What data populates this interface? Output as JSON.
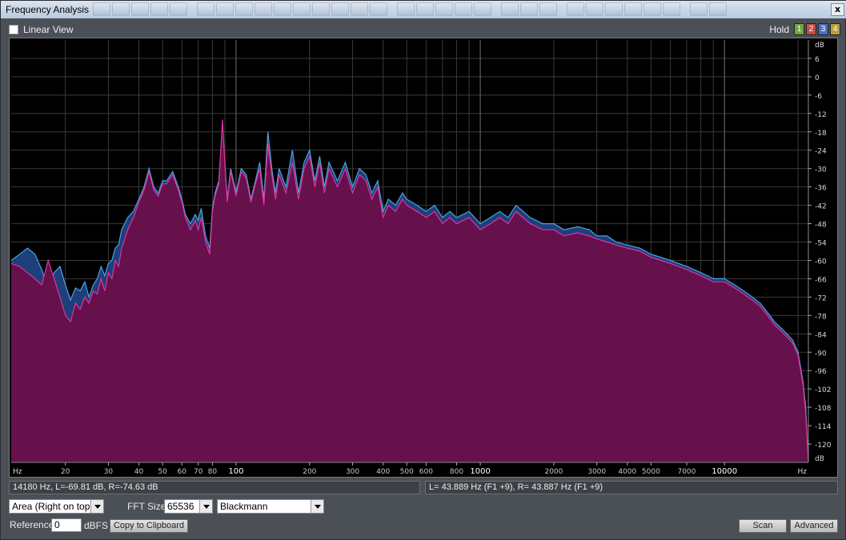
{
  "window": {
    "title": "Frequency Analysis",
    "close_label": "x"
  },
  "top": {
    "linear_view_label": "Linear View",
    "linear_view_checked": false,
    "hold_label": "Hold",
    "hold_buttons": [
      {
        "label": "1",
        "color": "#6ea83a"
      },
      {
        "label": "2",
        "color": "#c0504d"
      },
      {
        "label": "3",
        "color": "#4f6fc5"
      },
      {
        "label": "4",
        "color": "#b8a13a"
      }
    ]
  },
  "chart_data": {
    "type": "area",
    "x_scale": "log",
    "xlim": [
      12,
      22050
    ],
    "ylim": [
      -126,
      12
    ],
    "x_unit": "Hz",
    "y_unit": "dB",
    "x_ticks": [
      {
        "v": 20,
        "label": "20"
      },
      {
        "v": 30,
        "label": "30"
      },
      {
        "v": 40,
        "label": "40"
      },
      {
        "v": 50,
        "label": "50"
      },
      {
        "v": 60,
        "label": "60"
      },
      {
        "v": 70,
        "label": "70"
      },
      {
        "v": 80,
        "label": "80"
      },
      {
        "v": 100,
        "label": "100"
      },
      {
        "v": 200,
        "label": "200"
      },
      {
        "v": 300,
        "label": "300"
      },
      {
        "v": 400,
        "label": "400"
      },
      {
        "v": 500,
        "label": "500"
      },
      {
        "v": 600,
        "label": "600"
      },
      {
        "v": 800,
        "label": "800"
      },
      {
        "v": 1000,
        "label": "1000"
      },
      {
        "v": 2000,
        "label": "2000"
      },
      {
        "v": 3000,
        "label": "3000"
      },
      {
        "v": 4000,
        "label": "4000"
      },
      {
        "v": 5000,
        "label": "5000"
      },
      {
        "v": 7000,
        "label": "7000"
      },
      {
        "v": 10000,
        "label": "10000"
      }
    ],
    "y_ticks": [
      6,
      0,
      -6,
      -12,
      -18,
      -24,
      -30,
      -36,
      -42,
      -48,
      -54,
      -60,
      -66,
      -72,
      -78,
      -84,
      -90,
      -96,
      -102,
      -108,
      -114,
      -120
    ],
    "series": [
      {
        "channel": "L",
        "fill": "#1e3f7a",
        "stroke": "#4aa3e0",
        "points": [
          [
            12,
            -60
          ],
          [
            13,
            -58
          ],
          [
            14,
            -56
          ],
          [
            15,
            -58
          ],
          [
            16,
            -63
          ],
          [
            17,
            -69
          ],
          [
            18,
            -64
          ],
          [
            19,
            -62
          ],
          [
            20,
            -68
          ],
          [
            21,
            -73
          ],
          [
            22,
            -69
          ],
          [
            23,
            -70
          ],
          [
            24,
            -67
          ],
          [
            25,
            -72
          ],
          [
            26,
            -68
          ],
          [
            27,
            -66
          ],
          [
            28,
            -62
          ],
          [
            29,
            -65
          ],
          [
            30,
            -61
          ],
          [
            31,
            -60
          ],
          [
            32,
            -56
          ],
          [
            33,
            -55
          ],
          [
            34,
            -50
          ],
          [
            36,
            -46
          ],
          [
            38,
            -44
          ],
          [
            40,
            -40
          ],
          [
            42,
            -36
          ],
          [
            44,
            -30
          ],
          [
            46,
            -36
          ],
          [
            48,
            -38
          ],
          [
            50,
            -34
          ],
          [
            52,
            -34
          ],
          [
            55,
            -31
          ],
          [
            58,
            -36
          ],
          [
            60,
            -40
          ],
          [
            62,
            -45
          ],
          [
            65,
            -48
          ],
          [
            68,
            -45
          ],
          [
            70,
            -47
          ],
          [
            72,
            -43
          ],
          [
            75,
            -52
          ],
          [
            78,
            -56
          ],
          [
            80,
            -43
          ],
          [
            82,
            -38
          ],
          [
            85,
            -34
          ],
          [
            88,
            -16
          ],
          [
            90,
            -28
          ],
          [
            92,
            -40
          ],
          [
            95,
            -30
          ],
          [
            100,
            -38
          ],
          [
            105,
            -30
          ],
          [
            110,
            -32
          ],
          [
            115,
            -40
          ],
          [
            120,
            -34
          ],
          [
            125,
            -28
          ],
          [
            130,
            -40
          ],
          [
            135,
            -18
          ],
          [
            140,
            -30
          ],
          [
            145,
            -38
          ],
          [
            150,
            -30
          ],
          [
            160,
            -36
          ],
          [
            170,
            -24
          ],
          [
            180,
            -38
          ],
          [
            190,
            -28
          ],
          [
            200,
            -24
          ],
          [
            210,
            -34
          ],
          [
            220,
            -26
          ],
          [
            230,
            -36
          ],
          [
            240,
            -28
          ],
          [
            260,
            -34
          ],
          [
            280,
            -28
          ],
          [
            300,
            -36
          ],
          [
            320,
            -30
          ],
          [
            340,
            -32
          ],
          [
            360,
            -38
          ],
          [
            380,
            -34
          ],
          [
            400,
            -44
          ],
          [
            420,
            -40
          ],
          [
            450,
            -42
          ],
          [
            480,
            -38
          ],
          [
            500,
            -40
          ],
          [
            550,
            -42
          ],
          [
            600,
            -44
          ],
          [
            650,
            -42
          ],
          [
            700,
            -46
          ],
          [
            750,
            -44
          ],
          [
            800,
            -46
          ],
          [
            900,
            -44
          ],
          [
            1000,
            -48
          ],
          [
            1100,
            -46
          ],
          [
            1200,
            -44
          ],
          [
            1300,
            -46
          ],
          [
            1400,
            -42
          ],
          [
            1600,
            -46
          ],
          [
            1800,
            -48
          ],
          [
            2000,
            -48
          ],
          [
            2200,
            -50
          ],
          [
            2500,
            -49
          ],
          [
            2800,
            -50
          ],
          [
            3000,
            -52
          ],
          [
            3300,
            -52
          ],
          [
            3600,
            -54
          ],
          [
            4000,
            -55
          ],
          [
            4500,
            -56
          ],
          [
            5000,
            -58
          ],
          [
            5500,
            -59
          ],
          [
            6000,
            -60
          ],
          [
            7000,
            -62
          ],
          [
            8000,
            -64
          ],
          [
            9000,
            -66
          ],
          [
            10000,
            -66
          ],
          [
            11000,
            -68
          ],
          [
            12000,
            -70
          ],
          [
            13000,
            -72
          ],
          [
            14000,
            -74
          ],
          [
            15000,
            -77
          ],
          [
            16000,
            -80
          ],
          [
            17000,
            -82
          ],
          [
            18000,
            -84
          ],
          [
            19000,
            -86
          ],
          [
            20000,
            -90
          ],
          [
            21000,
            -100
          ],
          [
            21500,
            -108
          ],
          [
            22050,
            -126
          ]
        ]
      },
      {
        "channel": "R",
        "fill": "#66104c",
        "stroke": "#e0359c",
        "points": [
          [
            12,
            -61
          ],
          [
            13,
            -62
          ],
          [
            14,
            -64
          ],
          [
            15,
            -66
          ],
          [
            16,
            -68
          ],
          [
            17,
            -60
          ],
          [
            18,
            -66
          ],
          [
            19,
            -72
          ],
          [
            20,
            -78
          ],
          [
            21,
            -80
          ],
          [
            22,
            -74
          ],
          [
            23,
            -76
          ],
          [
            24,
            -72
          ],
          [
            25,
            -74
          ],
          [
            26,
            -70
          ],
          [
            27,
            -71
          ],
          [
            28,
            -66
          ],
          [
            29,
            -70
          ],
          [
            30,
            -64
          ],
          [
            31,
            -66
          ],
          [
            32,
            -60
          ],
          [
            33,
            -62
          ],
          [
            34,
            -56
          ],
          [
            36,
            -50
          ],
          [
            38,
            -46
          ],
          [
            40,
            -41
          ],
          [
            42,
            -37
          ],
          [
            44,
            -31
          ],
          [
            46,
            -37
          ],
          [
            48,
            -39
          ],
          [
            50,
            -35
          ],
          [
            52,
            -35
          ],
          [
            55,
            -32
          ],
          [
            58,
            -37
          ],
          [
            60,
            -41
          ],
          [
            62,
            -46
          ],
          [
            65,
            -50
          ],
          [
            68,
            -47
          ],
          [
            70,
            -50
          ],
          [
            72,
            -46
          ],
          [
            75,
            -54
          ],
          [
            78,
            -58
          ],
          [
            80,
            -44
          ],
          [
            82,
            -39
          ],
          [
            85,
            -35
          ],
          [
            88,
            -14
          ],
          [
            90,
            -29
          ],
          [
            92,
            -41
          ],
          [
            95,
            -31
          ],
          [
            100,
            -39
          ],
          [
            105,
            -31
          ],
          [
            110,
            -33
          ],
          [
            115,
            -41
          ],
          [
            120,
            -35
          ],
          [
            125,
            -30
          ],
          [
            130,
            -42
          ],
          [
            135,
            -22
          ],
          [
            140,
            -32
          ],
          [
            145,
            -40
          ],
          [
            150,
            -32
          ],
          [
            160,
            -38
          ],
          [
            170,
            -28
          ],
          [
            180,
            -40
          ],
          [
            190,
            -30
          ],
          [
            200,
            -26
          ],
          [
            210,
            -36
          ],
          [
            220,
            -28
          ],
          [
            230,
            -38
          ],
          [
            240,
            -30
          ],
          [
            260,
            -36
          ],
          [
            280,
            -30
          ],
          [
            300,
            -38
          ],
          [
            320,
            -32
          ],
          [
            340,
            -34
          ],
          [
            360,
            -40
          ],
          [
            380,
            -36
          ],
          [
            400,
            -46
          ],
          [
            420,
            -42
          ],
          [
            450,
            -44
          ],
          [
            480,
            -40
          ],
          [
            500,
            -42
          ],
          [
            550,
            -44
          ],
          [
            600,
            -46
          ],
          [
            650,
            -44
          ],
          [
            700,
            -48
          ],
          [
            750,
            -46
          ],
          [
            800,
            -48
          ],
          [
            900,
            -46
          ],
          [
            1000,
            -50
          ],
          [
            1100,
            -48
          ],
          [
            1200,
            -46
          ],
          [
            1300,
            -48
          ],
          [
            1400,
            -44
          ],
          [
            1600,
            -48
          ],
          [
            1800,
            -50
          ],
          [
            2000,
            -50
          ],
          [
            2200,
            -52
          ],
          [
            2500,
            -51
          ],
          [
            2800,
            -52
          ],
          [
            3000,
            -53
          ],
          [
            3300,
            -54
          ],
          [
            3600,
            -55
          ],
          [
            4000,
            -56
          ],
          [
            4500,
            -57
          ],
          [
            5000,
            -59
          ],
          [
            5500,
            -60
          ],
          [
            6000,
            -61
          ],
          [
            7000,
            -63
          ],
          [
            8000,
            -65
          ],
          [
            9000,
            -67
          ],
          [
            10000,
            -67
          ],
          [
            11000,
            -69
          ],
          [
            12000,
            -71
          ],
          [
            13000,
            -73
          ],
          [
            14000,
            -75
          ],
          [
            15000,
            -78
          ],
          [
            16000,
            -81
          ],
          [
            17000,
            -83
          ],
          [
            18000,
            -85
          ],
          [
            19000,
            -87
          ],
          [
            20000,
            -91
          ],
          [
            21000,
            -101
          ],
          [
            21500,
            -110
          ],
          [
            22050,
            -126
          ]
        ]
      }
    ]
  },
  "status": {
    "cursor_readout": "14180 Hz, L=-69.81 dB, R=-74.63 dB",
    "peak_readout": "L= 43.889 Hz (F1 +9), R= 43.887 Hz (F1 +9)"
  },
  "controls": {
    "display_mode": "Area (Right on top)",
    "fft_size_label": "FFT Size",
    "fft_size": "65536",
    "window_fn": "Blackmann",
    "reference_label": "Reference",
    "reference_value": "0",
    "reference_unit": "dBFS",
    "copy_label": "Copy to Clipboard",
    "scan_label": "Scan",
    "advanced_label": "Advanced"
  }
}
